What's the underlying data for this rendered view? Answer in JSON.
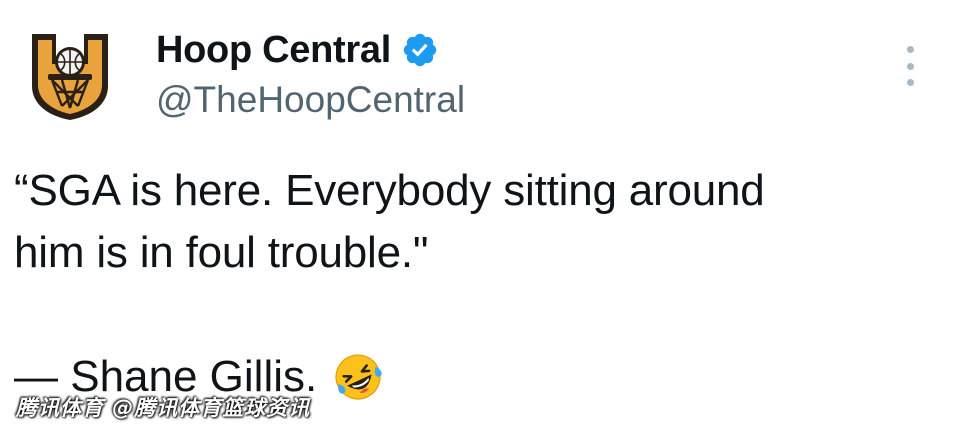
{
  "author": {
    "display_name": "Hoop Central",
    "handle": "@TheHoopCentral",
    "verified": true
  },
  "tweet": {
    "line1": "“SGA is here. Everybody sitting around",
    "line2": "him is in foul trouble.\"",
    "attribution": "— Shane Gillis.",
    "emoji": "rolling-on-floor-laughing"
  },
  "watermark": "腾讯体育 @腾讯体育篮球资讯",
  "colors": {
    "text": "#0f1419",
    "handle": "#536471",
    "verified": "#1d9bf0",
    "more_dots": "#aab8c2",
    "logo_gold": "#e8a33c",
    "logo_dark": "#2b2016"
  },
  "icons": [
    "hoop-central-logo",
    "verified-badge-icon",
    "more-options-icon",
    "laughing-emoji-icon"
  ]
}
